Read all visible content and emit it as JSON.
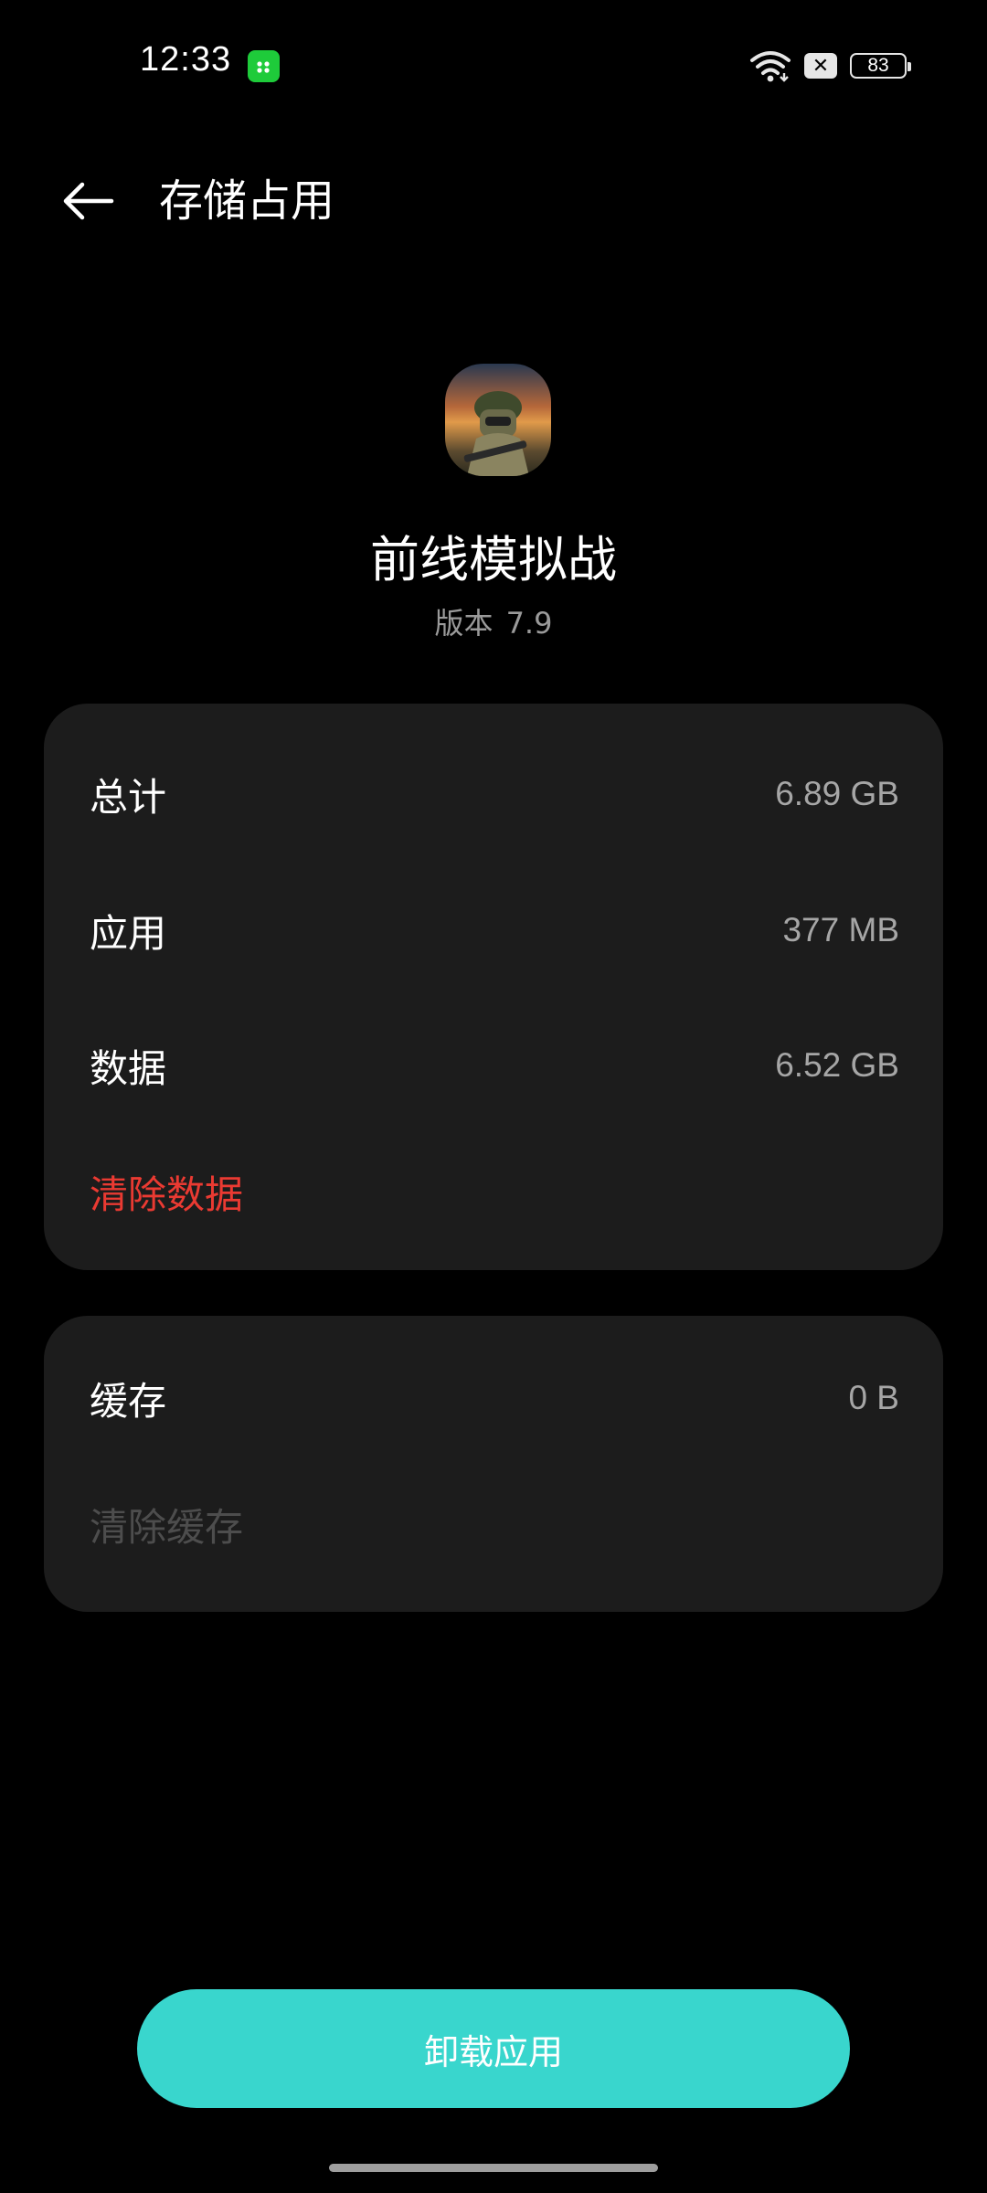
{
  "status_bar": {
    "time": "12:33",
    "battery": "83",
    "icons": [
      "app-notification-icon",
      "wifi-icon",
      "sim-x-icon",
      "battery-icon"
    ]
  },
  "header": {
    "title": "存储占用",
    "back_icon": "back-arrow-icon"
  },
  "app": {
    "name": "前线模拟战",
    "version_label": "版本",
    "version_number": "7.9"
  },
  "storage": {
    "rows": [
      {
        "label": "总计",
        "value": "6.89 GB"
      },
      {
        "label": "应用",
        "value": "377 MB"
      },
      {
        "label": "数据",
        "value": "6.52 GB"
      }
    ],
    "clear_data_label": "清除数据"
  },
  "cache": {
    "label": "缓存",
    "value": "0 B",
    "clear_cache_label": "清除缓存"
  },
  "bottom": {
    "uninstall_label": "卸载应用"
  },
  "colors": {
    "background": "#000000",
    "card": "#1c1c1c",
    "accent": "#39d6cd",
    "danger": "#ea3a32",
    "disabled": "#4d4d4d"
  }
}
